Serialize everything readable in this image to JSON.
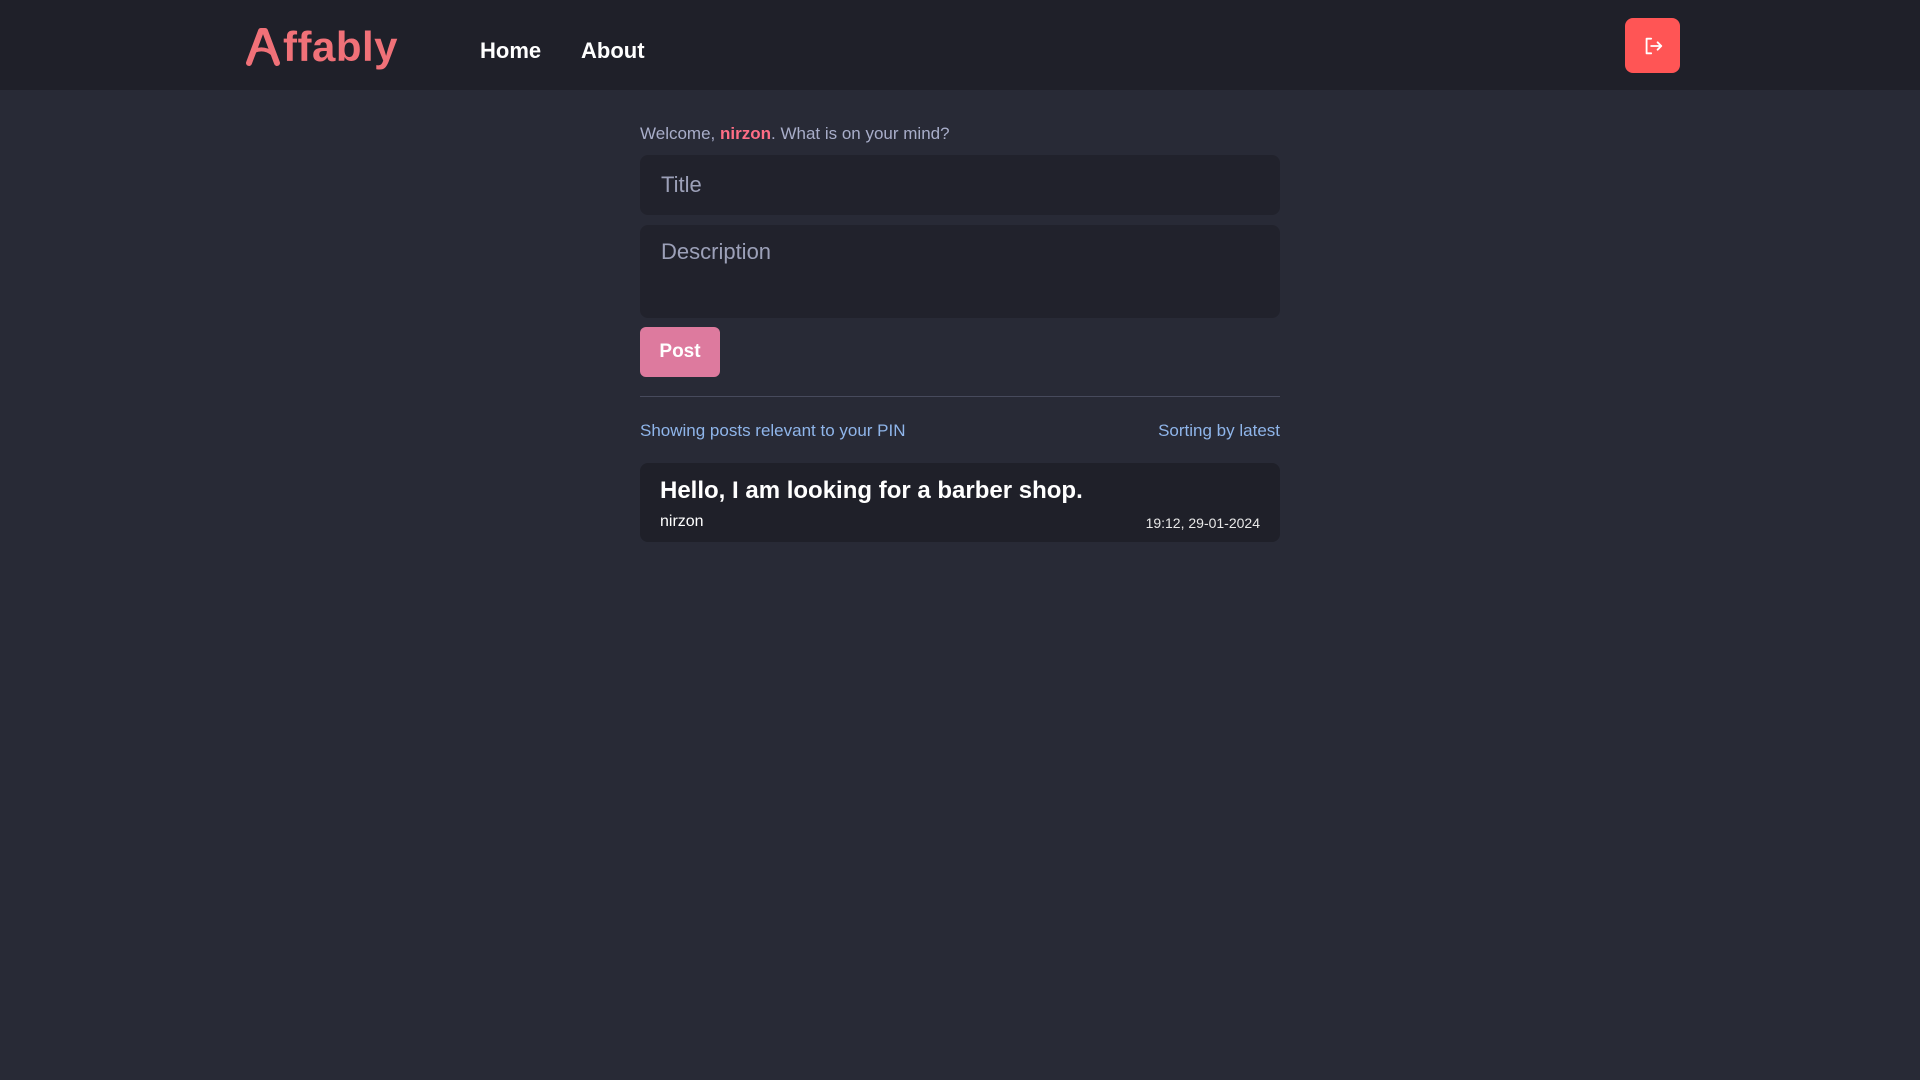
{
  "brand": {
    "logo_mark": "A",
    "name": "ffably",
    "color": "#f07178"
  },
  "nav": {
    "home": "Home",
    "about": "About"
  },
  "header": {
    "logout_icon": "logout-icon",
    "logout_color": "#ff5555"
  },
  "composer": {
    "welcome_prefix": "Welcome, ",
    "username": "nirzon",
    "welcome_suffix": ". What is on your mind?",
    "title_placeholder": "Title",
    "description_placeholder": "Description",
    "post_label": "Post"
  },
  "feed": {
    "relevance_text": "Showing posts relevant to your PIN",
    "sorting_text": "Sorting by latest",
    "posts": [
      {
        "title": "Hello, I am looking for a barber shop.",
        "author": "nirzon",
        "timestamp": "19:12, 29-01-2024"
      }
    ]
  }
}
